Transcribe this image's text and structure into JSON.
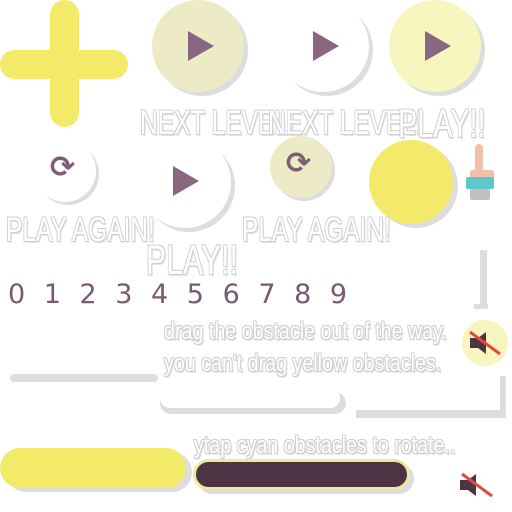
{
  "labels": {
    "next_level_1": "NEXT LEVEL!",
    "next_level_2": "NEXT LEVEL!",
    "play_1": "PLAY!!",
    "play_2": "PLAY!!",
    "play_again_1": "PLAY AGAIN!",
    "play_again_2": "PLAY AGAIN!"
  },
  "digits": "0 1 2 3 4 5 6 7 8 9",
  "tutorial": {
    "line1": "drag the obstacle out of the way.",
    "line2": "you can't drag yellow obstacles.",
    "line3": "ytap cyan obstacles to rotate.."
  },
  "icons": {
    "plus": "plus-icon",
    "play": "play-icon",
    "reload": "reload-icon",
    "hand": "pointer-hand-icon",
    "mute": "mute-icon"
  },
  "colors": {
    "yellow": "#f4ea69",
    "pale_yellow": "#f7f6bf",
    "plum": "#8a6680",
    "dark_plum": "#4c3445",
    "shadow": "#dddddd"
  }
}
